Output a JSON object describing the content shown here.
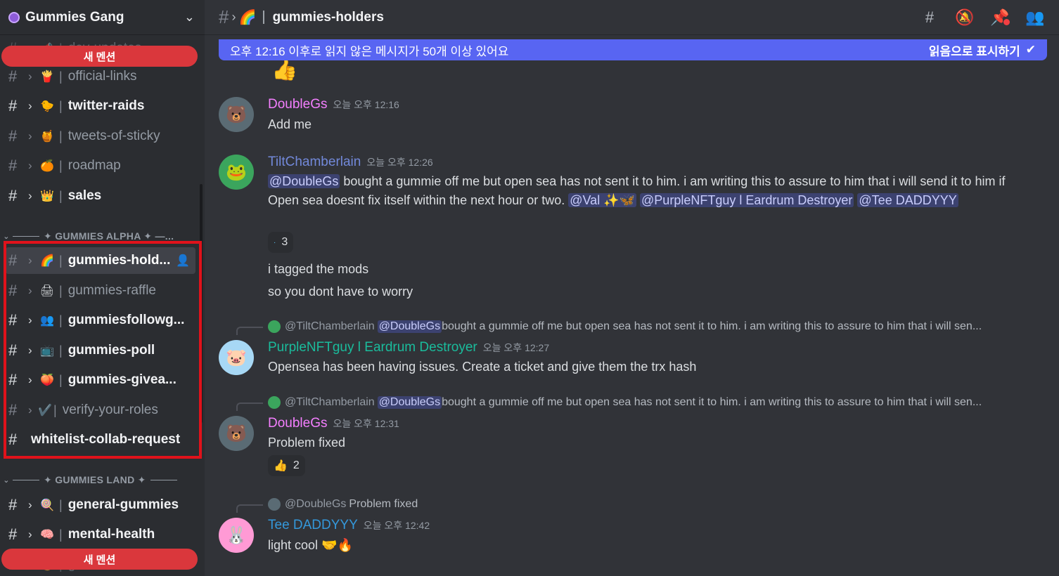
{
  "server": {
    "name": "Gummies Gang"
  },
  "mention_pill": "새 멘션",
  "sidebar": {
    "top_channels": [
      {
        "emoji": "📣",
        "name": "dev-updates",
        "state": "muted"
      },
      {
        "emoji": "🍟",
        "name": "official-links",
        "state": "muted"
      },
      {
        "emoji": "🐤",
        "name": "twitter-raids",
        "state": "unread"
      },
      {
        "emoji": "🍯",
        "name": "tweets-of-sticky",
        "state": "muted"
      },
      {
        "emoji": "🍊",
        "name": "roadmap",
        "state": "muted"
      },
      {
        "emoji": "👑",
        "name": "sales",
        "state": "unread"
      }
    ],
    "category_alpha": "✦ GUMMIES ALPHA ✦ —...",
    "alpha_channels": [
      {
        "emoji": "🌈",
        "name": "gummies-hold...",
        "state": "active"
      },
      {
        "emoji": "🖨",
        "name": "gummies-raffle",
        "state": "muted"
      },
      {
        "emoji": "👥",
        "name": "gummiesfollowg...",
        "state": "unread"
      },
      {
        "emoji": "📺",
        "name": "gummies-poll",
        "state": "unread"
      },
      {
        "emoji": "🍑",
        "name": "gummies-givea...",
        "state": "unread"
      },
      {
        "emoji": "✔️",
        "name": "verify-your-roles",
        "state": "muted"
      },
      {
        "emoji": "",
        "name": "whitelist-collab-request",
        "state": "unread"
      }
    ],
    "category_land": "✦ GUMMIES LAND ✦",
    "land_channels": [
      {
        "emoji": "🍭",
        "name": "general-gummies",
        "state": "unread"
      },
      {
        "emoji": "🧠",
        "name": "mental-health",
        "state": "unread"
      },
      {
        "emoji": "🔥",
        "name": "gummies-art",
        "state": "muted"
      }
    ]
  },
  "topbar": {
    "emoji": "🌈",
    "title": "gummies-holders"
  },
  "unread_bar": {
    "text": "오후 12:16 이후로 읽지 않은 메시지가 50개 이상 있어요",
    "action": "읽음으로 표시하기"
  },
  "messages": [
    {
      "author": "DoubleGs",
      "color": "#f47fff",
      "time": "오늘 오후 12:16",
      "lines": [
        "Add me"
      ]
    },
    {
      "author": "TiltChamberlain",
      "color": "#7289da",
      "time": "오늘 오후 12:26",
      "mention1": "@DoubleGs",
      "body1": " bought a gummie off me but open sea has not sent it to him.  i am writing this to assure to him that i will send it to him if Open sea doesnt fix itself within the next hour or two. ",
      "mention2": "@Val ✨🦋",
      "mention3": "@PurpleNFTguy l Eardrum Destroyer",
      "mention4": "@Tee DADDYYY",
      "reaction_count": "3",
      "follow1": "i tagged the mods",
      "follow2": "so you dont have to worry"
    },
    {
      "reply_name": "@TiltChamberlain",
      "reply_mention": "@DoubleGs",
      "reply_text": " bought a gummie off me but open sea has not sent it to him.  i am writing this to assure to him that i will sen...",
      "author": "PurpleNFTguy l Eardrum Destroyer",
      "color": "#1abc9c",
      "time": "오늘 오후 12:27",
      "body": "Opensea has been having issues. Create a ticket and give them the trx hash"
    },
    {
      "reply_name": "@TiltChamberlain",
      "reply_mention": "@DoubleGs",
      "reply_text": " bought a gummie off me but open sea has not sent it to him.  i am writing this to assure to him that i will sen...",
      "author": "DoubleGs",
      "color": "#f47fff",
      "time": "오늘 오후 12:31",
      "body": "Problem fixed",
      "reaction_emoji": "👍",
      "reaction_count": "2"
    },
    {
      "reply_name": "@DoubleGs",
      "reply_text": "Problem fixed",
      "author": "Tee DADDYYY",
      "color": "#3498db",
      "time": "오늘 오후 12:42",
      "body": "light cool 🤝🔥"
    }
  ]
}
